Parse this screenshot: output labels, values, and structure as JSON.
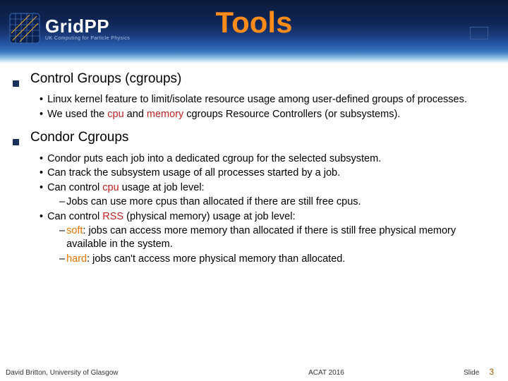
{
  "logo": {
    "main": "Grid",
    "suffix": "PP",
    "tagline": "UK Computing for Particle Physics"
  },
  "title": "Tools",
  "sections": [
    {
      "heading": "Control Groups (cgroups)",
      "bullets": [
        {
          "parts": [
            {
              "t": "Linux kernel feature to limit/isolate resource usage among user-defined groups of processes."
            }
          ]
        },
        {
          "parts": [
            {
              "t": "We used the "
            },
            {
              "t": "cpu",
              "c": "hl-red"
            },
            {
              "t": " and "
            },
            {
              "t": "memory",
              "c": "hl-red"
            },
            {
              "t": " cgroups Resource Controllers (or subsystems)."
            }
          ]
        }
      ]
    },
    {
      "heading": "Condor Cgroups",
      "bullets": [
        {
          "parts": [
            {
              "t": "Condor puts each job into a dedicated cgroup for the selected subsystem."
            }
          ]
        },
        {
          "parts": [
            {
              "t": "Can track the subsystem usage of all processes started by a job."
            }
          ]
        },
        {
          "parts": [
            {
              "t": "Can control "
            },
            {
              "t": "cpu",
              "c": "hl-red"
            },
            {
              "t": " usage at job level:"
            }
          ],
          "subs": [
            {
              "parts": [
                {
                  "t": "Jobs can use more cpus than allocated if there are still free cpus."
                }
              ]
            }
          ]
        },
        {
          "parts": [
            {
              "t": "Can control "
            },
            {
              "t": "RSS",
              "c": "hl-red"
            },
            {
              "t": " (physical memory) usage at job level:"
            }
          ],
          "subs": [
            {
              "parts": [
                {
                  "t": "soft",
                  "c": "hl-orange"
                },
                {
                  "t": ": jobs can access more memory than allocated if there is still free physical memory available in the system."
                }
              ]
            },
            {
              "parts": [
                {
                  "t": "hard",
                  "c": "hl-orange"
                },
                {
                  "t": ": jobs can't access more physical memory than allocated."
                }
              ]
            }
          ]
        }
      ]
    }
  ],
  "footer": {
    "author": "David Britton, University of Glasgow",
    "conference": "ACAT 2016",
    "slide_label": "Slide",
    "page": "3"
  }
}
